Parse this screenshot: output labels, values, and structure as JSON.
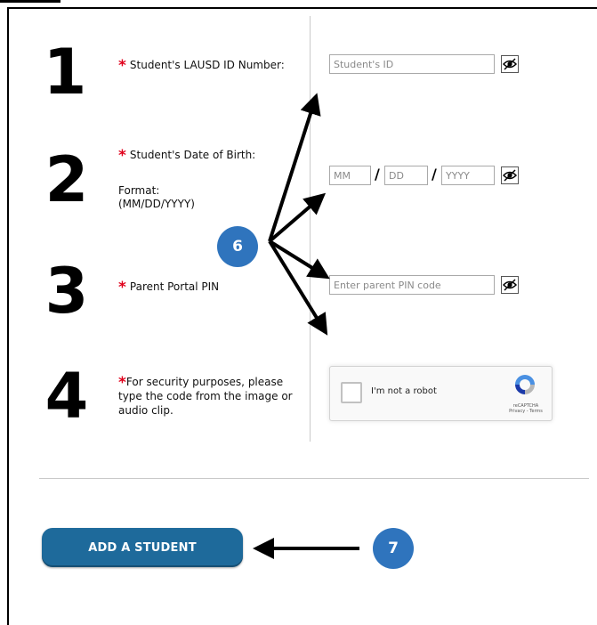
{
  "steps": [
    {
      "number": "1",
      "label": "Student's LAUSD ID Number:"
    },
    {
      "number": "2",
      "label": "Student's Date of Birth:",
      "format_label": "Format:",
      "format_value": "(MM/DD/YYYY)"
    },
    {
      "number": "3",
      "label": "Parent Portal PIN"
    },
    {
      "number": "4",
      "label": "For security purposes, please type the code from the image or audio clip."
    }
  ],
  "required_marker": "*",
  "inputs": {
    "student_id": {
      "placeholder": "Student's ID",
      "value": ""
    },
    "dob_month": {
      "placeholder": "MM",
      "value": ""
    },
    "dob_day": {
      "placeholder": "DD",
      "value": ""
    },
    "dob_year": {
      "placeholder": "YYYY",
      "value": ""
    },
    "dob_separator": "/",
    "pin": {
      "placeholder": "Enter parent PIN code",
      "value": ""
    }
  },
  "recaptcha": {
    "label": "I'm not a robot",
    "brand": "reCAPTCHA",
    "links": "Privacy - Terms"
  },
  "add_button_label": "ADD A STUDENT",
  "callouts": {
    "six": "6",
    "seven": "7"
  },
  "colors": {
    "required": "#e0001b",
    "button": "#1e6a9b",
    "callout": "#2f74bd"
  },
  "icons": {
    "toggle_visibility": "eye-icon"
  }
}
